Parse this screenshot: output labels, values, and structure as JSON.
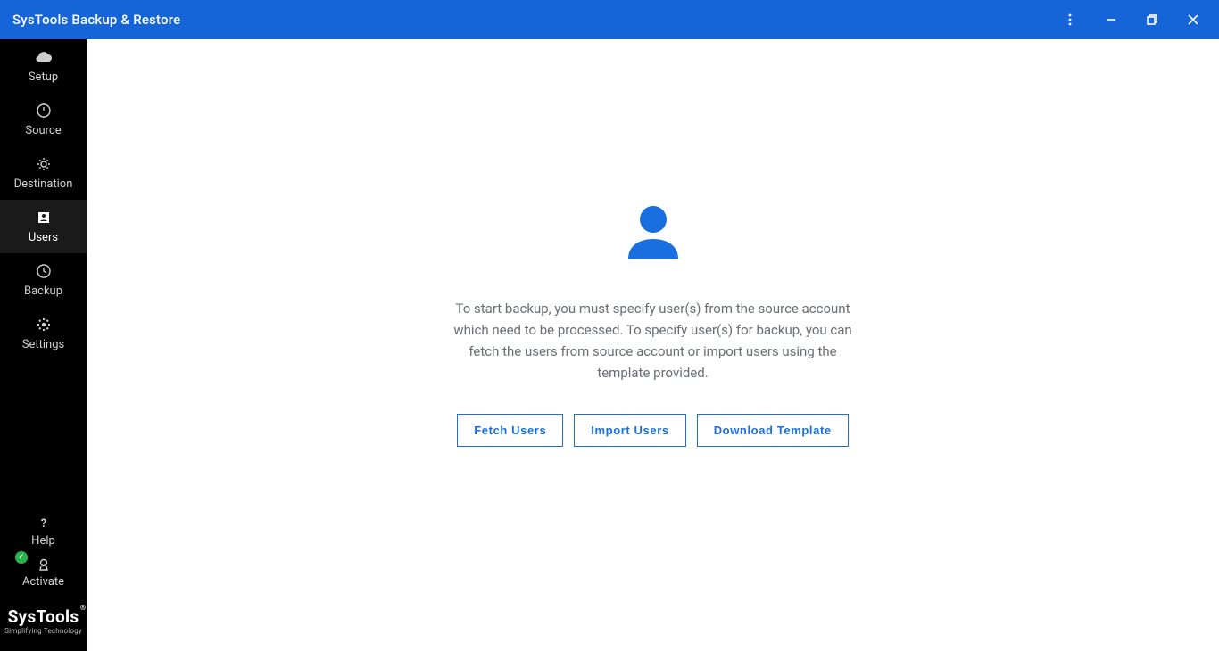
{
  "titlebar": {
    "title": "SysTools Backup & Restore"
  },
  "sidebar": {
    "items": [
      {
        "id": "setup",
        "label": "Setup",
        "active": false
      },
      {
        "id": "source",
        "label": "Source",
        "active": false
      },
      {
        "id": "destination",
        "label": "Destination",
        "active": false
      },
      {
        "id": "users",
        "label": "Users",
        "active": true
      },
      {
        "id": "backup",
        "label": "Backup",
        "active": false
      },
      {
        "id": "settings",
        "label": "Settings",
        "active": false
      }
    ],
    "bottom": [
      {
        "id": "help",
        "label": "Help"
      },
      {
        "id": "activate",
        "label": "Activate"
      }
    ],
    "brand": {
      "name": "SysTools",
      "tagline": "Simplifying Technology"
    }
  },
  "main": {
    "description": "To start backup, you must specify user(s) from the source account which need to be processed. To specify user(s) for backup, you can fetch the users from source account or import users using the template provided.",
    "buttons": {
      "fetch": "Fetch Users",
      "import": "Import Users",
      "download": "Download Template"
    }
  }
}
